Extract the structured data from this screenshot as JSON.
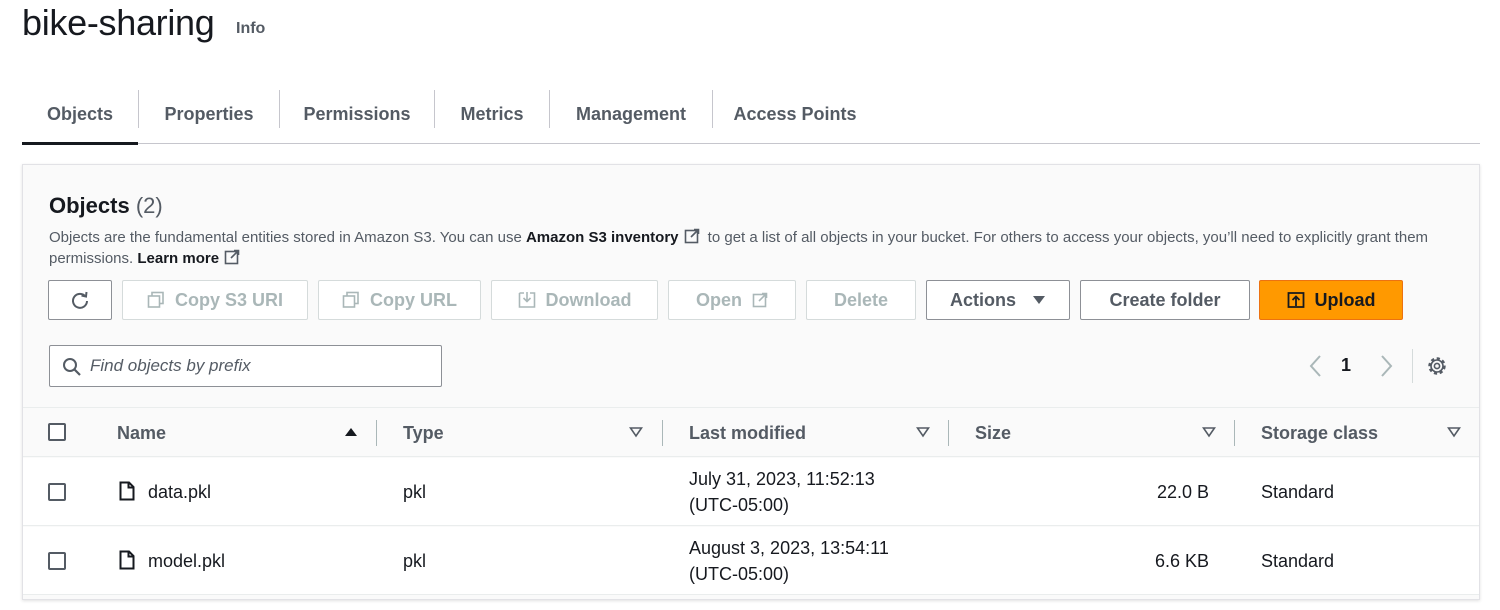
{
  "header": {
    "bucket_name": "bike-sharing",
    "info_label": "Info"
  },
  "tabs": [
    {
      "label": "Objects",
      "active": true
    },
    {
      "label": "Properties"
    },
    {
      "label": "Permissions"
    },
    {
      "label": "Metrics"
    },
    {
      "label": "Management"
    },
    {
      "label": "Access Points"
    }
  ],
  "panel": {
    "title": "Objects",
    "count": "(2)",
    "desc_part1": "Objects are the fundamental entities stored in Amazon S3. You can use ",
    "desc_link1": "Amazon S3 inventory",
    "desc_part2": " to get a list of all objects in your bucket. For others to access your objects, you’ll need to explicitly grant them permissions. ",
    "desc_link2": "Learn more"
  },
  "toolbar": {
    "refresh_icon": "refresh-icon",
    "copy_s3_uri": "Copy S3 URI",
    "copy_url": "Copy URL",
    "download": "Download",
    "open": "Open",
    "delete": "Delete",
    "actions": "Actions",
    "create_folder": "Create folder",
    "upload": "Upload"
  },
  "search": {
    "placeholder": "Find objects by prefix",
    "value": ""
  },
  "pagination": {
    "current_page": "1"
  },
  "table": {
    "headers": {
      "name": "Name",
      "type": "Type",
      "last_modified": "Last modified",
      "size": "Size",
      "storage_class": "Storage class"
    },
    "rows": [
      {
        "name": "data.pkl",
        "type": "pkl",
        "modified_date": "July 31, 2023, 11:52:13",
        "modified_tz": "(UTC-05:00)",
        "size": "22.0 B",
        "storage_class": "Standard"
      },
      {
        "name": "model.pkl",
        "type": "pkl",
        "modified_date": "August 3, 2023, 13:54:11",
        "modified_tz": "(UTC-05:00)",
        "size": "6.6 KB",
        "storage_class": "Standard"
      }
    ]
  },
  "colors": {
    "accent": "#ff9900",
    "text_primary": "#16191f",
    "text_secondary": "#545b64",
    "disabled": "#aab7b8"
  }
}
